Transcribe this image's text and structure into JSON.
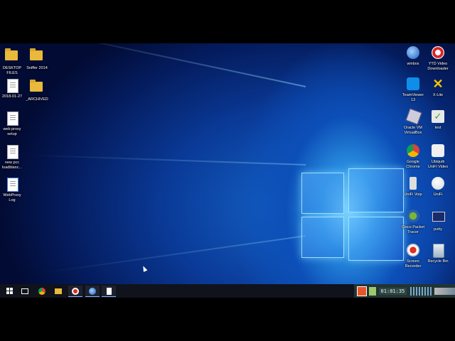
{
  "desktop": {
    "left_icons": [
      {
        "label": "DESKTOP\nFILES",
        "icon": "folder-icon"
      },
      {
        "label": "Sniffer 2014",
        "icon": "folder-icon"
      },
      {
        "label": "2018-01-27",
        "icon": "document-icon"
      },
      {
        "label": "_ARCHIVED",
        "icon": "folder-icon"
      },
      {
        "label": "web proxy\nsetup",
        "icon": "document-icon"
      },
      {
        "label": "new pcc\nloadblanc...",
        "icon": "document-icon"
      },
      {
        "label": "WebProxy\nLog",
        "icon": "document-icon"
      }
    ],
    "right_icons": [
      {
        "label": "winbox",
        "icon": "winbox-icon"
      },
      {
        "label": "YTD Video\nDownloader",
        "icon": "ytd-icon"
      },
      {
        "label": "TeamViewer\n13",
        "icon": "teamviewer-icon"
      },
      {
        "label": "X-Lite",
        "icon": "xlite-icon"
      },
      {
        "label": "Oracle VM\nVirtualBox",
        "icon": "virtualbox-icon"
      },
      {
        "label": "test",
        "icon": "test-icon"
      },
      {
        "label": "Google\nChrome",
        "icon": "chrome-icon"
      },
      {
        "label": "Ubiquiti\nUniFi Video",
        "icon": "unifi-video-icon"
      },
      {
        "label": "UniFi Voip",
        "icon": "unifi-voip-icon"
      },
      {
        "label": "UniFi",
        "icon": "unifi-icon"
      },
      {
        "label": "Cisco Packet\nTracer",
        "icon": "packet-tracer-icon"
      },
      {
        "label": "putty",
        "icon": "putty-icon"
      },
      {
        "label": "Screen\nRecorder",
        "icon": "screen-recorder-icon"
      },
      {
        "label": "Recycle Bin",
        "icon": "recycle-bin-icon"
      }
    ]
  },
  "taskbar": {
    "buttons": [
      "start-icon",
      "task-view-icon",
      "chrome-icon",
      "file-explorer-icon",
      "screen-recorder-icon",
      "winbox-icon",
      "document-icon"
    ],
    "tray_text": "01:01:35"
  },
  "colors": {
    "taskbar": "#10131c",
    "folder": "#e8b93a"
  }
}
